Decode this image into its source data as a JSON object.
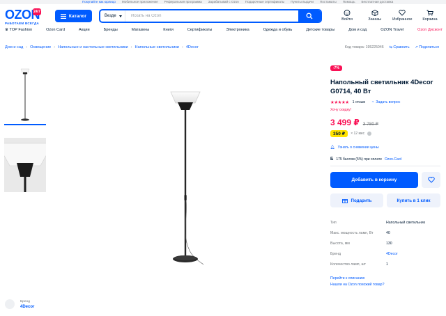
{
  "topbar": [
    "Покупайте как юрлицо",
    "Мобильное приложение",
    "Реферальная программа",
    "Зарабатывай с Ozon",
    "Подарочные сертификаты",
    "Пункты выдачи",
    "Постаматы",
    "Помощь",
    "Бесплатная доставка"
  ],
  "logo": {
    "word": "OZON",
    "sub": "РАБОТАЕМ ВСЕГДА",
    "badge": "24/7"
  },
  "header": {
    "catalog_label": "Каталог",
    "search_scope": "Везде",
    "search_placeholder": "Искать на Ozon",
    "actions": [
      {
        "label": "Войти",
        "icon": "user-icon"
      },
      {
        "label": "Заказы",
        "icon": "box-icon"
      },
      {
        "label": "Избранное",
        "icon": "heart-icon"
      },
      {
        "label": "Корзина",
        "icon": "cart-icon"
      }
    ]
  },
  "nav": [
    "TOP Fashion",
    "Ozon Card",
    "Акции",
    "Бренды",
    "Магазины",
    "Книги",
    "Сертификаты",
    "Электроника",
    "Одежда и обувь",
    "Детские товары",
    "Дом и сад",
    "OZON Travel",
    "Ozon Дисконт"
  ],
  "breadcrumbs": [
    "Дом и сад",
    "Освещение",
    "Напольные и настольные светильники",
    "Напольные светильники",
    "4Decor"
  ],
  "product_meta": {
    "code": "Код товара: 195225046",
    "compare": "Сравнить",
    "share": "Поделиться"
  },
  "product": {
    "discount": "-7%",
    "title": "Напольный светильник 4Decor G0714, 40 Вт",
    "stars": 5,
    "reviews": "1 отзыв",
    "ask": "Задать вопрос",
    "want_discount": "Хочу скидку!",
    "price": "3 499 ₽",
    "old_price": "3 780 ₽",
    "installment_price": "350 ₽",
    "installment_text": "× 12 мес",
    "notify": "Узнать о снижении цены",
    "bonus_icon": "Б",
    "bonus_text": "175 баллов (5%) при оплате",
    "bonus_link": "Ozon.Card"
  },
  "buttons": {
    "add_to_cart": "Добавить в корзину",
    "gift": "Подарить",
    "one_click": "Купить в 1 клик"
  },
  "specs": [
    {
      "key": "Тип",
      "value": "Напольный светильник",
      "link": false
    },
    {
      "key": "Макс. мощность ламп, Вт",
      "value": "40",
      "link": false
    },
    {
      "key": "Высота, мм",
      "value": "130",
      "link": false
    },
    {
      "key": "Бренд",
      "value": "4Decor",
      "link": true
    },
    {
      "key": "Количество ламп, шт",
      "value": "1",
      "link": false
    }
  ],
  "links": {
    "description": "Перейти к описанию",
    "similar": "Нашли на Ozon похожий товар?"
  },
  "brand_box": {
    "caption": "Бренд",
    "name": "4Decor"
  },
  "colors": {
    "primary": "#005bff",
    "accent": "#f91155",
    "yellow": "#ffe200",
    "text": "#001a34"
  }
}
